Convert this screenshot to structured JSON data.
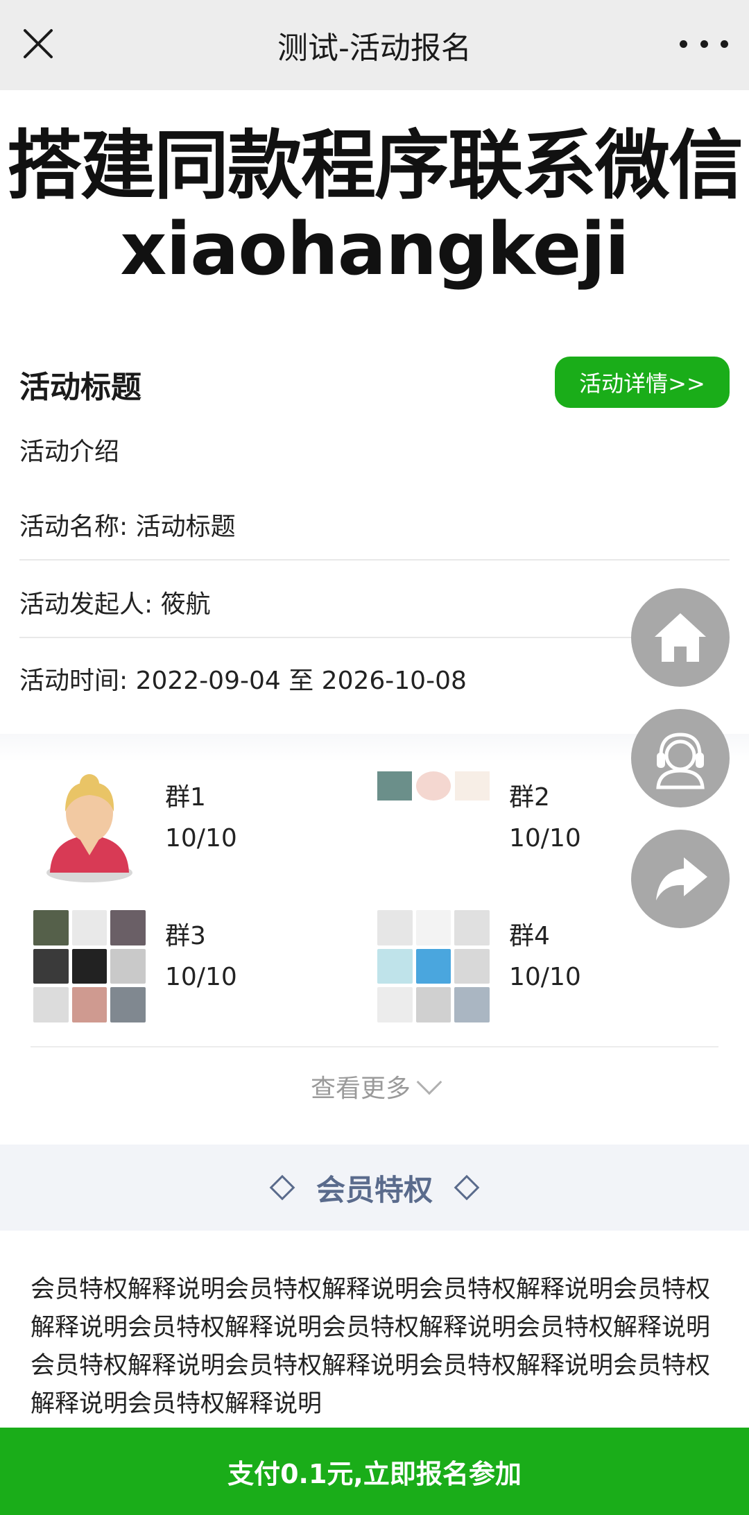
{
  "nav": {
    "title": "测试-活动报名"
  },
  "banner": {
    "line1": "搭建同款程序联系微信",
    "line2": "xiaohangkeji"
  },
  "activity": {
    "title": "活动标题",
    "detail_button": "活动详情>>",
    "intro": "活动介绍",
    "name_row": "活动名称: 活动标题",
    "initiator_row": "活动发起人: 筱航",
    "time_row": "活动时间: 2022-09-04 至 2026-10-08"
  },
  "groups": [
    {
      "name": "群1",
      "count": "10/10"
    },
    {
      "name": "群2",
      "count": "10/10"
    },
    {
      "name": "群3",
      "count": "10/10"
    },
    {
      "name": "群4",
      "count": "10/10"
    }
  ],
  "more_link": "查看更多",
  "member": {
    "title": "会员特权",
    "text": "会员特权解释说明会员特权解释说明会员特权解释说明会员特权解释说明会员特权解释说明会员特权解释说明会员特权解释说明会员特权解释说明会员特权解释说明会员特权解释说明会员特权解释说明会员特权解释说明"
  },
  "pay_button": "支付0.1元,立即报名参加",
  "colors": {
    "primary_green": "#1aad19",
    "nav_bg": "#ededed",
    "float_btn": "#a8a8a8",
    "member_accent": "#5a6b8c"
  },
  "icons": {
    "close": "close-icon",
    "more": "more-dots-icon",
    "home": "home-icon",
    "service": "customer-service-icon",
    "share": "share-icon",
    "chevron": "chevron-down-icon",
    "diamond": "diamond-icon"
  }
}
